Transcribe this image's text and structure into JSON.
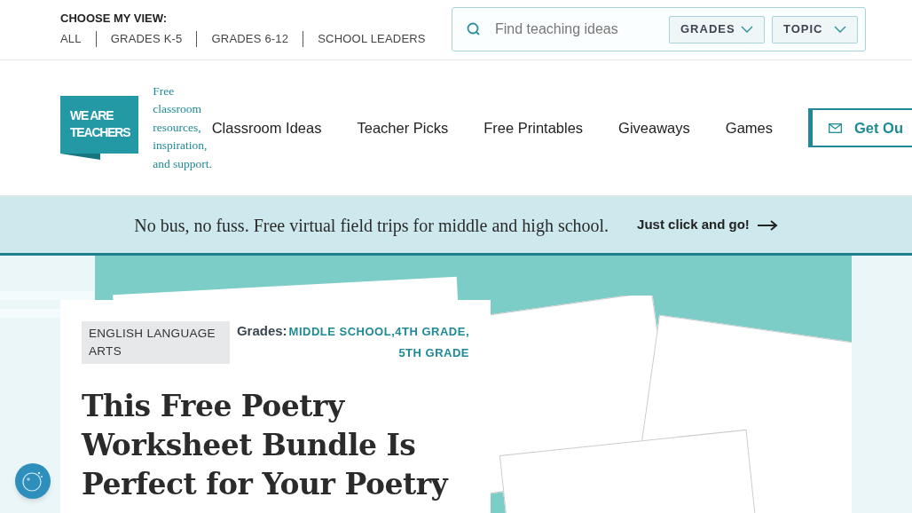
{
  "view_switcher": {
    "label": "CHOOSE MY VIEW:",
    "options": [
      {
        "label": "ALL",
        "selected": false
      },
      {
        "label": "GRADES K-5",
        "selected": false
      },
      {
        "label": "GRADES 6-12",
        "selected": false
      },
      {
        "label": "SCHOOL LEADERS",
        "selected": false
      }
    ]
  },
  "search": {
    "placeholder": "Find teaching ideas",
    "filters": [
      "GRADES",
      "TOPIC"
    ]
  },
  "logo": {
    "lines": [
      "WE ARE",
      "TEACHERS"
    ],
    "tagline": "Free classroom resources, inspiration, and support."
  },
  "nav": [
    "Classroom Ideas",
    "Teacher Picks",
    "Free Printables",
    "Giveaways",
    "Games"
  ],
  "nav_cta": "Get Ou",
  "banner": {
    "text": "No bus, no fuss. Free virtual field trips for middle and high school.",
    "link": "Just click and go!"
  },
  "article": {
    "category": "ENGLISH LANGUAGE ARTS",
    "grades_label": "Grades:",
    "grades": [
      "MIDDLE SCHOOL,",
      "4TH GRADE,",
      "5TH GRADE"
    ],
    "title": "This Free Poetry Worksheet Bundle Is Perfect for Your Poetry"
  }
}
